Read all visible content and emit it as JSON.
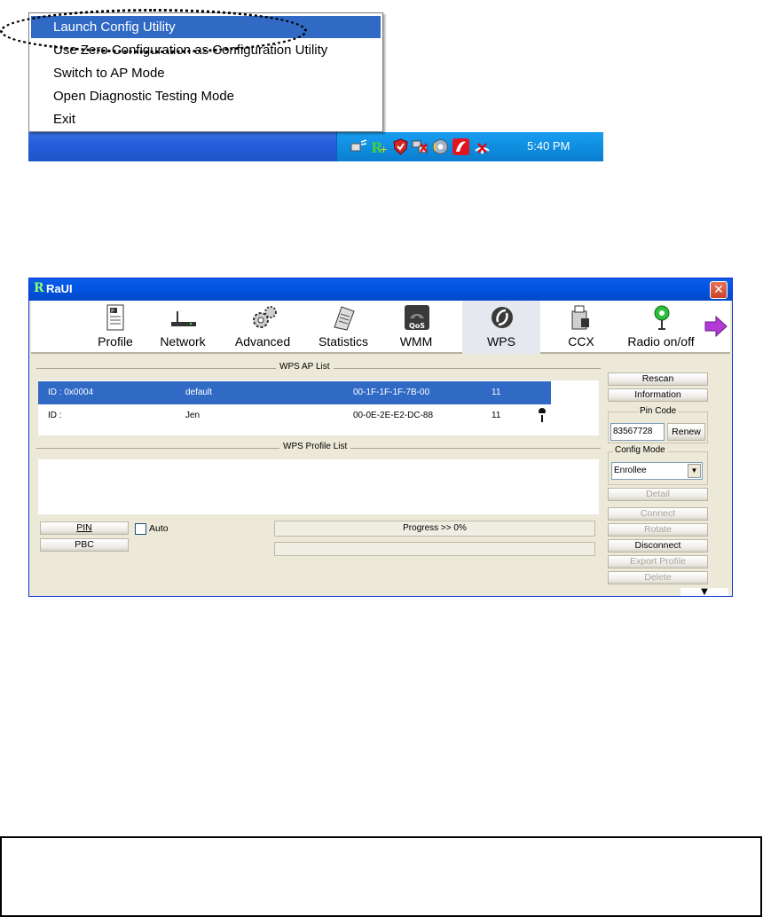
{
  "context_menu": {
    "items": [
      {
        "label": "Launch Config Utility",
        "highlighted": true
      },
      {
        "label": "Use Zero Configuration as Configuration Utility",
        "highlighted": false
      },
      {
        "label": "Switch to AP Mode",
        "highlighted": false
      },
      {
        "label": "Open Diagnostic Testing Mode",
        "highlighted": false
      },
      {
        "label": "Exit",
        "highlighted": false
      }
    ]
  },
  "taskbar": {
    "clock": "5:40 PM",
    "tray_icons": [
      "network-activity-icon",
      "ralink-utility-icon",
      "security-shield-icon",
      "network-disconnected-icon",
      "media-icon",
      "antivirus-icon",
      "wireless-signal-icon"
    ]
  },
  "window": {
    "title": "RaUI",
    "logo": "R",
    "toolbar": [
      {
        "label": "Profile",
        "icon": "profile-icon"
      },
      {
        "label": "Network",
        "icon": "network-icon"
      },
      {
        "label": "Advanced",
        "icon": "advanced-icon"
      },
      {
        "label": "Statistics",
        "icon": "statistics-icon"
      },
      {
        "label": "WMM",
        "icon": "wmm-icon",
        "badge": "QoS"
      },
      {
        "label": "WPS",
        "icon": "wps-icon",
        "selected": true
      },
      {
        "label": "CCX",
        "icon": "ccx-icon"
      },
      {
        "label": "Radio on/off",
        "icon": "radio-icon"
      }
    ],
    "wps_ap_list": {
      "title": "WPS AP List",
      "rows": [
        {
          "id": "ID : 0x0004",
          "name": "default",
          "mac": "00-1F-1F-1F-7B-00",
          "channel": "11",
          "selected": true,
          "locked": false
        },
        {
          "id": "ID :",
          "name": "Jen",
          "mac": "00-0E-2E-E2-DC-88",
          "channel": "11",
          "selected": false,
          "locked": true
        }
      ]
    },
    "wps_profile_list": {
      "title": "WPS Profile List"
    },
    "buttons": {
      "pin": "PIN",
      "pbc": "PBC",
      "auto": "Auto",
      "rescan": "Rescan",
      "information": "Information",
      "renew": "Renew",
      "detail": "Detail",
      "connect": "Connect",
      "rotate": "Rotate",
      "disconnect": "Disconnect",
      "export_profile": "Export Profile",
      "delete": "Delete"
    },
    "pin_code": {
      "label": "Pin Code",
      "value": "83567728"
    },
    "config_mode": {
      "label": "Config Mode",
      "value": "Enrollee"
    },
    "progress": {
      "text": "Progress >> 0%",
      "percent": 0
    },
    "colors": {
      "title_bar": "#0053e1",
      "selection": "#316ac5"
    }
  }
}
